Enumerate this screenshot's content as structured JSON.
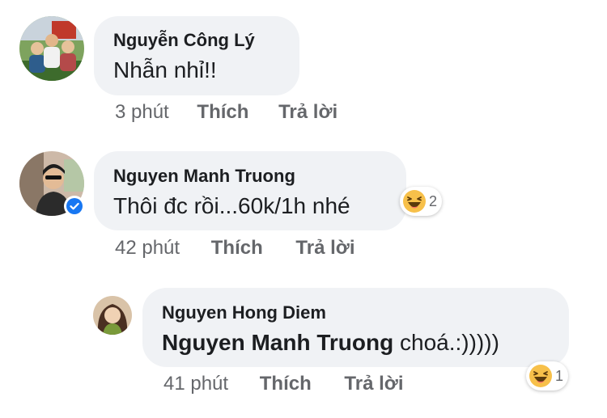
{
  "comments": [
    {
      "author": "Nguyễn Công Lý",
      "text": "Nhẫn nhỉ!!",
      "time": "3 phút",
      "like_label": "Thích",
      "reply_label": "Trả lời"
    },
    {
      "author": "Nguyen Manh Truong",
      "text": "Thôi đc rồi...60k/1h nhé",
      "time": "42 phút",
      "like_label": "Thích",
      "reply_label": "Trả lời",
      "reaction": {
        "icon": "haha-emoji-icon",
        "count": "2"
      },
      "verified": true
    }
  ],
  "reply": {
    "author": "Nguyen Hong Diem",
    "mention": "Nguyen Manh Truong",
    "text": " choá.:)))))",
    "time": "41 phút",
    "like_label": "Thích",
    "reply_label": "Trả lời",
    "reaction": {
      "icon": "haha-emoji-icon",
      "count": "1"
    }
  },
  "colors": {
    "bubble": "#f0f2f5",
    "text": "#1c1e21",
    "meta": "#65676b",
    "verified": "#1877f2"
  }
}
